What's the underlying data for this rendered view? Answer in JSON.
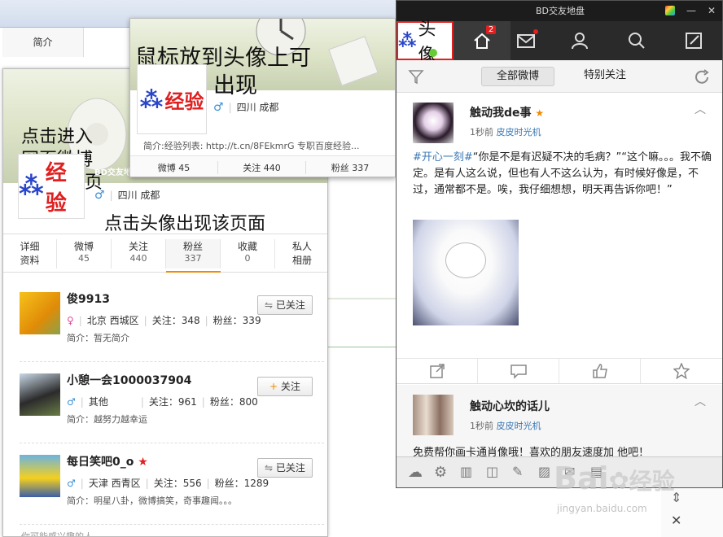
{
  "bg": {
    "tab_intro": "简介"
  },
  "profile": {
    "mini_title": "BD交友地盘",
    "location": "四川 成都",
    "stats": [
      {
        "label": "详细\n资料",
        "l1": "详细",
        "l2": "资料"
      },
      {
        "l1": "微博",
        "l2": "45"
      },
      {
        "l1": "关注",
        "l2": "440"
      },
      {
        "l1": "粉丝",
        "l2": "337"
      },
      {
        "l1": "收藏",
        "l2": "0"
      },
      {
        "l1": "私人",
        "l2": "相册"
      }
    ],
    "users": [
      {
        "name": "俊9913",
        "gender": "female",
        "location": "北京 西城区",
        "follow": "关注：348",
        "fans": "粉丝：339",
        "intro": "简介：暂无简介",
        "button": "已关注"
      },
      {
        "name": "小憩一会1000037904",
        "gender": "male",
        "location": "其他",
        "follow": "关注：961",
        "fans": "粉丝：800",
        "intro": "简介：越努力越幸运",
        "button": "关注"
      },
      {
        "name": "每日笑吧0_o",
        "gender": "male",
        "location": "天津 西青区",
        "follow": "关注：556",
        "fans": "粉丝：1289",
        "intro": "简介：明星八卦，微博搞笑，奇事趣闻。。。",
        "button": "已关注"
      }
    ],
    "footer": "你可能感兴趣的人"
  },
  "popup": {
    "location": "四川 成都",
    "intro": "简介:经验列表: http://t.cn/8FEkmrG 专职百度经验...",
    "stats": [
      "微博 45",
      "关注 440",
      "粉丝 337"
    ]
  },
  "annotations": {
    "hover": "鼠标放到头像上可",
    "hover2": "出现",
    "click_enter1": "点击进入",
    "click_enter2": "网页微博",
    "click_enter3": "主页",
    "click_avatar": "点击头像出现该页面",
    "avatar_label": "头像"
  },
  "client": {
    "title": "BD交友地盘",
    "home_badge": "2",
    "filter_all": "全部微博",
    "filter_special": "特别关注",
    "post1": {
      "author": "触动我de事",
      "time": "1秒前",
      "source": "皮皮时光机",
      "topic": "#开心一刻#",
      "text": "“你是不是有迟疑不决的毛病？”“这个嘛。。。我不确定。是有人这么说，但也有人不这么认为，有时候好像是，不过，通常都不是。唉，我仔细想想，明天再告诉你吧！”"
    },
    "post2": {
      "author": "触动心坎的话儿",
      "time": "1秒前",
      "source": "皮皮时光机",
      "text": "免费帮你画卡通肖像哦！喜欢的朋友速度加 他吧！"
    }
  },
  "watermark": {
    "line1": "Bai",
    "line2": "经验",
    "line3": "jingyan.baidu.com"
  },
  "colors": {
    "accent_red": "#e02020",
    "link_blue": "#3a78b4",
    "male_blue": "#3a8fd6",
    "female_pink": "#e04a9a",
    "orange": "#f08a00"
  }
}
